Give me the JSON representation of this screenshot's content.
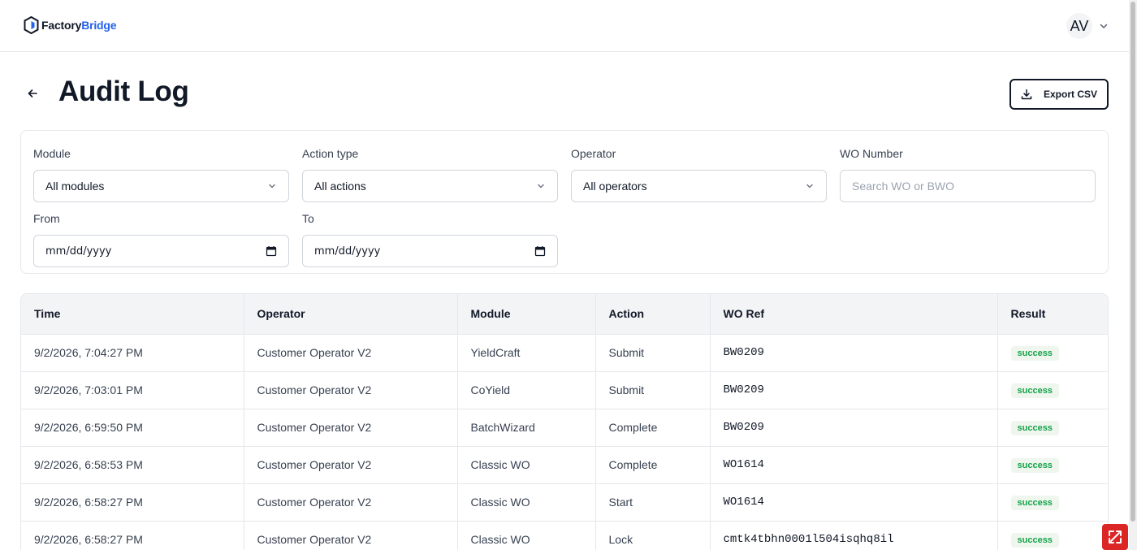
{
  "app": {
    "brand_prefix": "Factory",
    "brand_suffix": "Bridge",
    "user_initials": "AV"
  },
  "page": {
    "title": "Audit Log",
    "export_label": "Export CSV"
  },
  "filters": {
    "module": {
      "label": "Module",
      "value": "All modules"
    },
    "action_type": {
      "label": "Action type",
      "value": "All actions"
    },
    "operator": {
      "label": "Operator",
      "value": "All operators"
    },
    "wo_number": {
      "label": "WO Number",
      "placeholder": "Search WO or BWO"
    },
    "from": {
      "label": "From",
      "value": "mm/dd/yyyy"
    },
    "to": {
      "label": "To",
      "value": "mm/dd/yyyy"
    }
  },
  "table": {
    "columns": [
      "Time",
      "Operator",
      "Module",
      "Action",
      "WO Ref",
      "Result"
    ],
    "rows": [
      {
        "time": "9/2/2026, 7:04:27 PM",
        "operator": "Customer Operator V2",
        "module": "YieldCraft",
        "action": "Submit",
        "wo_ref": "BW0209",
        "result": "success"
      },
      {
        "time": "9/2/2026, 7:03:01 PM",
        "operator": "Customer Operator V2",
        "module": "CoYield",
        "action": "Submit",
        "wo_ref": "BW0209",
        "result": "success"
      },
      {
        "time": "9/2/2026, 6:59:50 PM",
        "operator": "Customer Operator V2",
        "module": "BatchWizard",
        "action": "Complete",
        "wo_ref": "BW0209",
        "result": "success"
      },
      {
        "time": "9/2/2026, 6:58:53 PM",
        "operator": "Customer Operator V2",
        "module": "Classic WO",
        "action": "Complete",
        "wo_ref": "WO1614",
        "result": "success"
      },
      {
        "time": "9/2/2026, 6:58:27 PM",
        "operator": "Customer Operator V2",
        "module": "Classic WO",
        "action": "Start",
        "wo_ref": "WO1614",
        "result": "success"
      },
      {
        "time": "9/2/2026, 6:58:27 PM",
        "operator": "Customer Operator V2",
        "module": "Classic WO",
        "action": "Lock",
        "wo_ref": "cmtk4tbhn0001l504isqhq8il",
        "result": "success"
      }
    ]
  },
  "colors": {
    "brand_accent": "#2563eb",
    "success_text": "#16a34a",
    "success_bg": "#eef6ee",
    "widget_red": "#dc2626"
  }
}
